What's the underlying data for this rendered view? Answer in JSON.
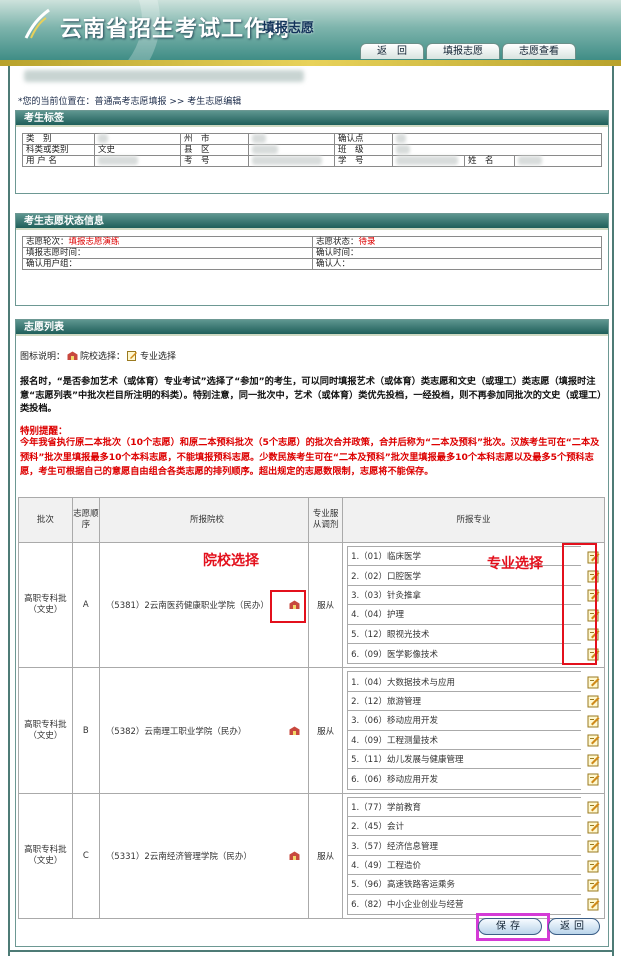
{
  "header": {
    "site_title": "云南省招生考试工作网",
    "site_subtitle": "填报志愿",
    "nav": [
      "返　回",
      "填报志愿",
      "志愿查看"
    ]
  },
  "breadcrumb": "*您的当前位置在：普通高考志愿填报 >> 考生志愿编辑",
  "candidate": {
    "title": "考生标签",
    "labels": {
      "category": "类　别",
      "city": "州　市",
      "confirm_point": "确认点",
      "subject": "科类或类别",
      "county": "县　区",
      "class": "班　级",
      "username": "用 户 名",
      "exam_no": "考　号",
      "student_no": "学　号",
      "name": "姓　名"
    },
    "values": {
      "subject": "文史"
    }
  },
  "status": {
    "title": "考生志愿状态信息",
    "round_label": "志愿轮次：",
    "round_value": "填报志愿演练",
    "state_label": "志愿状态：",
    "state_value": "待录",
    "fill_time_label": "填报志愿时间：",
    "confirm_time_label": "确认时间：",
    "confirm_group_label": "确认用户组：",
    "confirmer_label": "确认人："
  },
  "list": {
    "title": "志愿列表",
    "legend_label": "图标说明：",
    "legend_school": "院校选择：",
    "legend_major": "专业选择",
    "notice": "报名时，“是否参加艺术（或体育）专业考试”选择了“参加”的考生，可以同时填报艺术（或体育）类志愿和文史（或理工）类志愿（填报时注意“志愿列表”中批次栏目所注明的科类）。特别注意，同一批次中，艺术（或体育）类优先投档，一经投档，则不再参加同批次的文史（或理工）类投档。",
    "tip_title": "特别提醒：",
    "tip": "今年我省执行原二本批次（10个志愿）和原二本预科批次（5个志愿）的批次合并政策，合并后称为“二本及预科”批次。汉族考生可在“二本及预科”批次里填报最多10个本科志愿，不能填报预科志愿。少数民族考生可在“二本及预科”批次里填报最多10个本科志愿以及最多5个预科志愿，考生可根据自己的意愿自由组合各类志愿的排列顺序。超出规定的志愿数限制，志愿将不能保存。",
    "headers": [
      "批次",
      "志愿顺序",
      "所报院校",
      "专业服从调剂",
      "所报专业"
    ],
    "groups": [
      {
        "batch": "高职专科批（文史）",
        "seq": "A",
        "school": "（5381）2云南医药健康职业学院（民办）",
        "adjust": "服从",
        "majors": [
          "1.（01）临床医学",
          "2.（02）口腔医学",
          "3.（03）针灸推拿",
          "4.（04）护理",
          "5.（12）眼视光技术",
          "6.（09）医学影像技术"
        ]
      },
      {
        "batch": "高职专科批（文史）",
        "seq": "B",
        "school": "（5382）云南理工职业学院（民办）",
        "adjust": "服从",
        "majors": [
          "1.（04）大数据技术与应用",
          "2.（12）旅游管理",
          "3.（06）移动应用开发",
          "4.（09）工程测量技术",
          "5.（11）幼儿发展与健康管理",
          "6.（06）移动应用开发"
        ]
      },
      {
        "batch": "高职专科批（文史）",
        "seq": "C",
        "school": "（5331）2云南经济管理学院（民办）",
        "adjust": "服从",
        "majors": [
          "1.（77）学前教育",
          "2.（45）会计",
          "3.（57）经济信息管理",
          "4.（49）工程造价",
          "5.（96）高速铁路客运乘务",
          "6.（82）中小企业创业与经营"
        ]
      }
    ]
  },
  "annotations": {
    "school_select": "院校选择",
    "major_select": "专业选择"
  },
  "buttons": {
    "save": "保存",
    "back": "返回"
  },
  "colors": {
    "header_teal": "#3f8d86",
    "panel_head": "#1f5f5a",
    "notice_red": "#dd0000",
    "annotation_red": "#e3101c",
    "annotation_magenta": "#d43bd6"
  }
}
